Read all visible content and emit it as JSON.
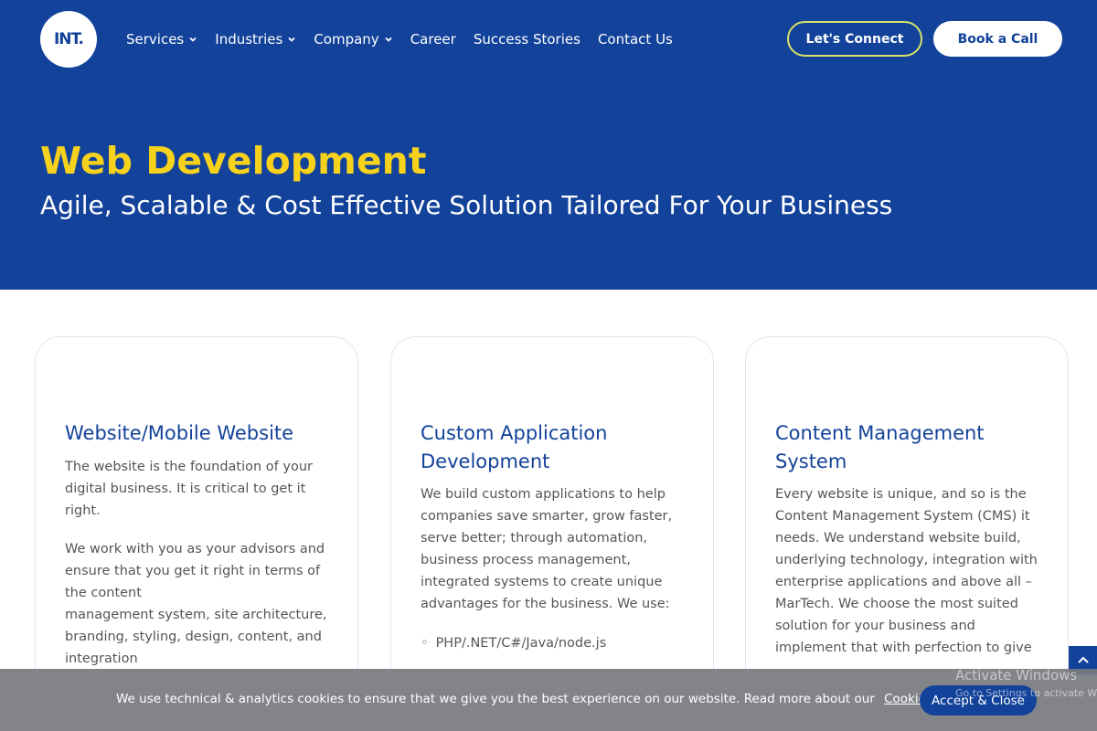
{
  "brand": {
    "logo_text": "INT."
  },
  "nav": {
    "items": [
      {
        "label": "Services",
        "has_dropdown": true
      },
      {
        "label": "Industries",
        "has_dropdown": true
      },
      {
        "label": "Company",
        "has_dropdown": true
      },
      {
        "label": "Career",
        "has_dropdown": false
      },
      {
        "label": "Success Stories",
        "has_dropdown": false
      },
      {
        "label": "Contact Us",
        "has_dropdown": false
      }
    ],
    "connect_label": "Let's Connect",
    "book_label": "Book a Call"
  },
  "hero": {
    "title": "Web Development",
    "subtitle": "Agile, Scalable & Cost Effective Solution Tailored For Your Business"
  },
  "cards": [
    {
      "title": "Website/Mobile Website",
      "paragraphs": [
        "The website is the foundation of your digital business. It is critical to get it right.",
        "We work with you as your advisors and ensure that you get it right in terms of the content",
        "management system, site architecture, branding, styling, design, content, and integration"
      ]
    },
    {
      "title": "Custom Application Development",
      "paragraphs": [
        "We build custom applications to help companies save smarter, grow faster, serve better; through automation, business process management, integrated systems to create unique advantages for the business. We use:"
      ],
      "list": [
        "PHP/.NET/C#/Java/node.js"
      ]
    },
    {
      "title": "Content Management System",
      "paragraphs": [
        "Every website is unique, and so is the Content Management System (CMS) it needs. We understand website build, underlying technology, integration with enterprise applications and above all – MarTech. We choose the most suited solution for your business and implement that with perfection to give"
      ]
    }
  ],
  "cookie": {
    "text": "We use technical & analytics cookies to ensure that we give you the best experience on our website. Read more about our",
    "link": "Cookies Policy",
    "accept_label": "Accept & Close"
  },
  "windows_watermark": {
    "line1": "Activate Windows",
    "line2": "Go to Settings to activate Wi"
  },
  "colors": {
    "brand_blue": "#12429a",
    "accent_yellow": "#f7d21c",
    "connect_border": "#d9e36a"
  }
}
